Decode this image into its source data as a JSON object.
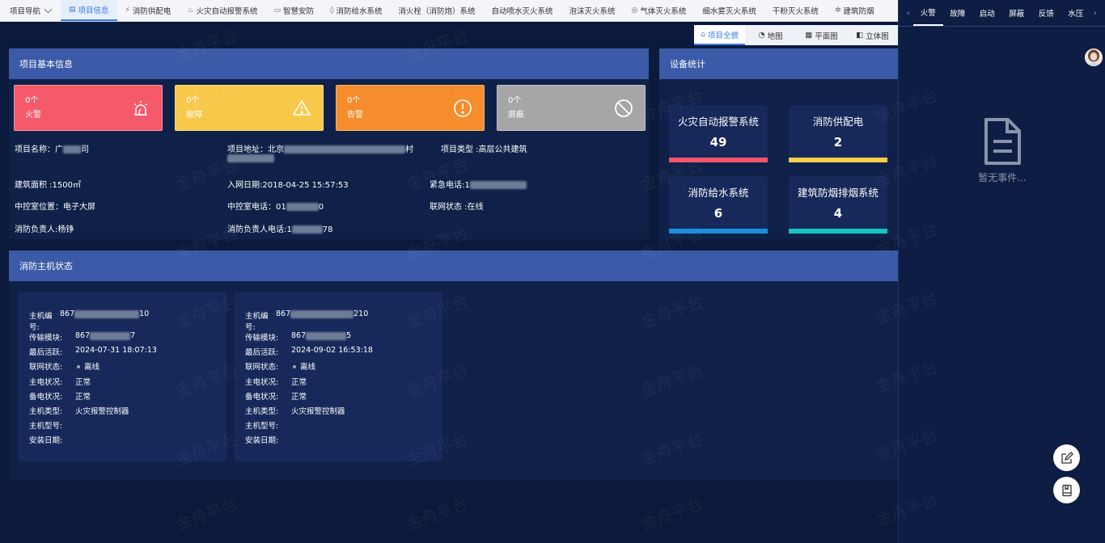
{
  "topnav": {
    "home": "项目导航",
    "items": [
      {
        "label": "项目信息",
        "icon": "▤"
      },
      {
        "label": "消防供配电",
        "icon": "⚡"
      },
      {
        "label": "火灾自动报警系统",
        "icon": "♨"
      },
      {
        "label": "智慧安防",
        "icon": "▭"
      },
      {
        "label": "消防给水系统",
        "icon": "◊"
      },
      {
        "label": "消火栓（消防炮）系统",
        "icon": ""
      },
      {
        "label": "自动喷水灭火系统",
        "icon": ""
      },
      {
        "label": "泡沫灭火系统",
        "icon": ""
      },
      {
        "label": "气体灭火系统",
        "icon": "◎"
      },
      {
        "label": "细水雾灭火系统",
        "icon": ""
      },
      {
        "label": "干粉灭火系统",
        "icon": ""
      },
      {
        "label": "建筑防烟",
        "icon": "✲"
      }
    ]
  },
  "viewtabs": [
    {
      "label": "项目全貌",
      "icon": "⌂"
    },
    {
      "label": "地图",
      "icon": "◔"
    },
    {
      "label": "平面图",
      "icon": "▦"
    },
    {
      "label": "立体图",
      "icon": "◧"
    }
  ],
  "basic": {
    "title": "项目基本信息",
    "alarms": [
      {
        "count": "0个",
        "label": "火警",
        "color": "#f55a6a"
      },
      {
        "count": "0个",
        "label": "故障",
        "color": "#f7c84a"
      },
      {
        "count": "0个",
        "label": "告警",
        "color": "#f58d2c"
      },
      {
        "count": "0个",
        "label": "屏蔽",
        "color": "#a6a6a6"
      }
    ],
    "name_label": "项目名称：",
    "name_value": "广",
    "name_tail": "司",
    "addr_label": "项目地址：北京",
    "addr_tail": "村",
    "type_label": "项目类型 :高层公共建筑",
    "area": "建筑面积 :1500㎡",
    "net_date": "入网日期:2018-04-25 15:57:53",
    "emergency": "紧急电话:1",
    "room_pos": "中控室位置：电子大屏",
    "room_phone_label": "中控室电话：01",
    "room_phone_tail": "0",
    "net_status": "联网状态 :在线",
    "owner": "消防负责人:杨铮",
    "owner_phone_label": "消防负责人电话:1",
    "owner_phone_tail": "78"
  },
  "stats": {
    "title": "设备统计",
    "cards": [
      {
        "name": "火灾自动报警系统",
        "value": "49",
        "color": "#f2566a"
      },
      {
        "name": "消防供配电",
        "value": "2",
        "color": "#f6cd4a"
      },
      {
        "name": "消防给水系统",
        "value": "6",
        "color": "#1a8fd8"
      },
      {
        "name": "建筑防烟排烟系统",
        "value": "4",
        "color": "#16c4c0"
      }
    ]
  },
  "hosts": {
    "title": "消防主机状态",
    "labels": {
      "code": "主机编号:",
      "module": "传输模块:",
      "last": "最后活跃:",
      "net": "联网状态:",
      "main_power": "主电状况:",
      "backup_power": "备电状况:",
      "type": "主机类型:",
      "model": "主机型号:",
      "install": "安装日期:"
    },
    "items": [
      {
        "code_head": "867",
        "code_tail": "10",
        "module_head": "867",
        "module_tail": "7",
        "last": "2024-07-31 18:07:13",
        "net": "离线",
        "main_power": "正常",
        "backup_power": "正常",
        "type": "火灾报警控制器",
        "model": "",
        "install": ""
      },
      {
        "code_head": "867",
        "code_tail": "210",
        "module_head": "867",
        "module_tail": "5",
        "last": "2024-09-02 16:53:18",
        "net": "离线",
        "main_power": "正常",
        "backup_power": "正常",
        "type": "火灾报警控制器",
        "model": "",
        "install": ""
      }
    ]
  },
  "events": {
    "tabs": [
      "火警",
      "故障",
      "启动",
      "屏蔽",
      "反馈",
      "水压"
    ],
    "empty": "暂无事件..."
  },
  "watermark": "金舟平台"
}
